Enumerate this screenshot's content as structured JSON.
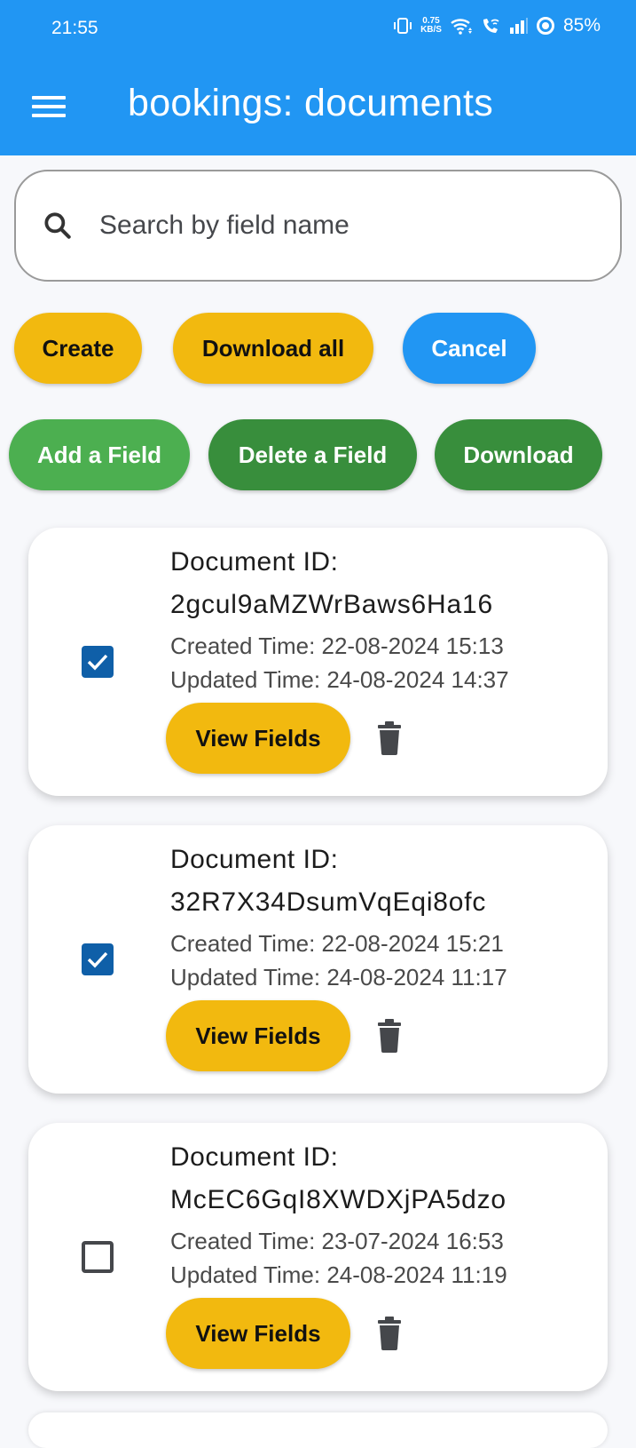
{
  "status_bar": {
    "time": "21:55",
    "net_speed_value": "0.75",
    "net_speed_unit": "KB/S",
    "battery": "85%",
    "icons": [
      "vibrate-icon",
      "wifi-icon",
      "wifi-calling-icon",
      "signal-icon",
      "battery-ring-icon"
    ]
  },
  "app_bar": {
    "title": "bookings: documents",
    "menu_icon": "hamburger-menu-icon",
    "color": "#2196f3"
  },
  "search": {
    "placeholder": "Search by field name",
    "value": "",
    "icon": "search-icon"
  },
  "actions_row1": [
    {
      "label": "Create",
      "color": "#f2b90f"
    },
    {
      "label": "Download all",
      "color": "#f2b90f"
    },
    {
      "label": "Cancel",
      "color": "#2196f3"
    }
  ],
  "actions_row2": [
    {
      "label": "Add a Field",
      "color": "#4caf50"
    },
    {
      "label": "Delete a Field",
      "color": "#388e3c"
    },
    {
      "label": "Download",
      "color": "#388e3c"
    }
  ],
  "documents": [
    {
      "id_label": "Document ID:",
      "id": "2gcul9aMZWrBaws6Ha16",
      "created": "Created Time: 22-08-2024 15:13",
      "updated": "Updated Time: 24-08-2024 14:37",
      "checked": true,
      "view_label": "View Fields"
    },
    {
      "id_label": "Document ID:",
      "id": "32R7X34DsumVqEqi8ofc",
      "created": "Created Time: 22-08-2024 15:21",
      "updated": "Updated Time: 24-08-2024 11:17",
      "checked": true,
      "view_label": "View Fields"
    },
    {
      "id_label": "Document ID:",
      "id": "McEC6GqI8XWDXjPA5dzo",
      "created": "Created Time: 23-07-2024 16:53",
      "updated": "Updated Time: 24-08-2024 11:19",
      "checked": false,
      "view_label": "View Fields"
    }
  ]
}
